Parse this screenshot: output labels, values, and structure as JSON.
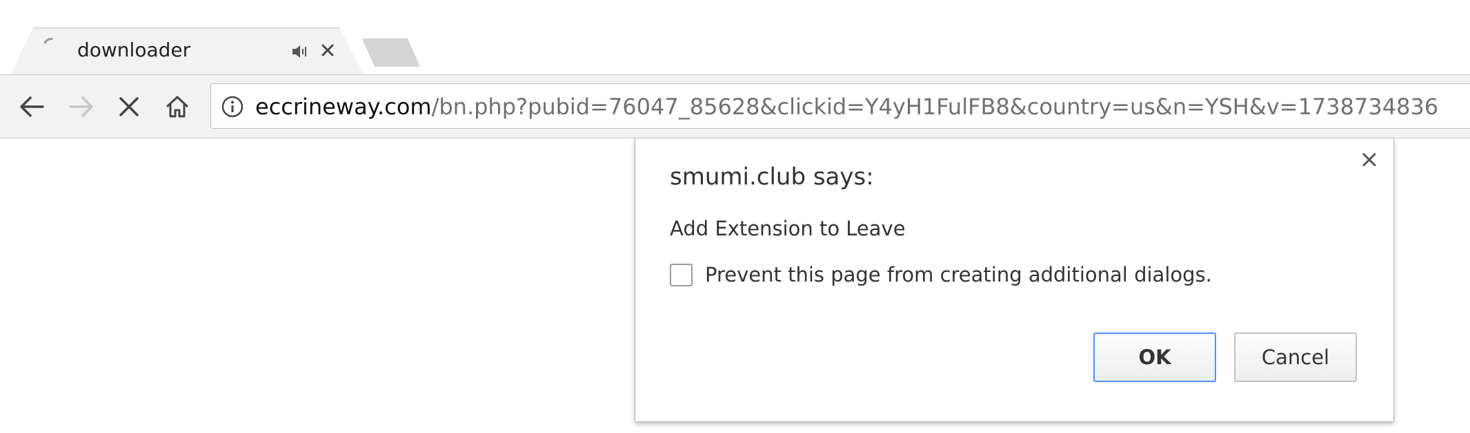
{
  "browser": {
    "tabs": [
      {
        "title": "downloader",
        "loading": true,
        "audio_playing": true
      }
    ],
    "toolbar": {
      "url_host": "eccrineway.com",
      "url_path": "/bn.php?pubid=76047_85628&clickid=Y4yH1FulFB8&country=us&n=YSH&v=1738734836"
    },
    "icons": {
      "back": "arrow-left-icon",
      "forward": "arrow-right-icon",
      "stop": "stop-x-icon",
      "home": "home-icon",
      "info": "info-circle-icon",
      "audio": "speaker-icon",
      "close": "close-icon"
    }
  },
  "dialog": {
    "title": "smumi.club says:",
    "message": "Add Extension to Leave",
    "checkbox_label": "Prevent this page from creating additional dialogs.",
    "checkbox_checked": false,
    "ok_label": "OK",
    "cancel_label": "Cancel",
    "accent": "#4d90fe"
  }
}
